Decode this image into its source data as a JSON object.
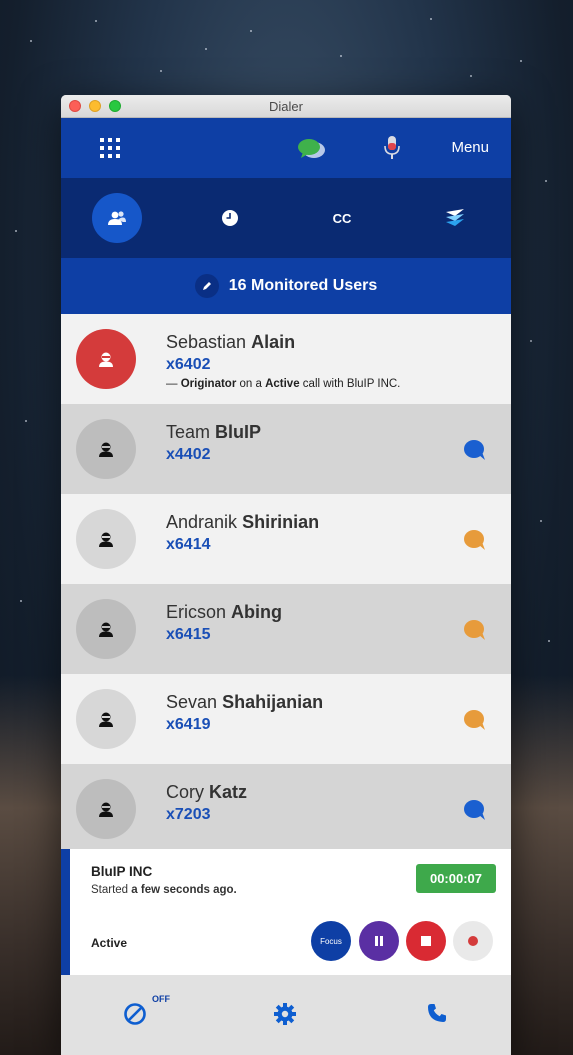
{
  "window": {
    "title": "Dialer"
  },
  "topbar": {
    "menu_label": "Menu"
  },
  "tabs": {
    "cc_label": "CC"
  },
  "monitored": {
    "label": "16 Monitored Users"
  },
  "users": [
    {
      "first": "Sebastian",
      "last": "Alain",
      "ext": "x6402",
      "status_pre": "— ",
      "status_role": "Originator",
      "status_mid": " on a ",
      "status_state": "Active",
      "status_post": " call with BluIP INC."
    },
    {
      "first": "Team",
      "last": "BluIP",
      "ext": "x4402",
      "bubble_color": "#1a5fd0"
    },
    {
      "first": "Andranik",
      "last": "Shirinian",
      "ext": "x6414",
      "bubble_color": "#e79b3b"
    },
    {
      "first": "Ericson",
      "last": "Abing",
      "ext": "x6415",
      "bubble_color": "#e79b3b"
    },
    {
      "first": "Sevan",
      "last": "Shahijanian",
      "ext": "x6419",
      "bubble_color": "#e79b3b"
    },
    {
      "first": "Cory",
      "last": "Katz",
      "ext": "x7203",
      "bubble_color": "#1a5fd0"
    }
  ],
  "call": {
    "name": "BluIP INC",
    "started_pre": "Started ",
    "started_time": "a few seconds ago.",
    "timer": "00:00:07",
    "state": "Active",
    "focus_label": "Focus"
  },
  "bottom": {
    "dnd_state": "OFF"
  },
  "colors": {
    "primary": "#0e3fa5",
    "busy": "#d43b3b",
    "timer": "#3ea94b",
    "stop": "#d92a33",
    "pause": "#5a2fa3"
  },
  "icons": [
    "dialpad-icon",
    "chat-icon",
    "microphone-icon",
    "contacts-icon",
    "clock-icon",
    "layers-icon",
    "pencil-icon",
    "user-icon",
    "chat-bubble-icon",
    "pause-icon",
    "stop-icon",
    "record-icon",
    "do-not-disturb-icon",
    "gear-icon",
    "phone-icon"
  ]
}
